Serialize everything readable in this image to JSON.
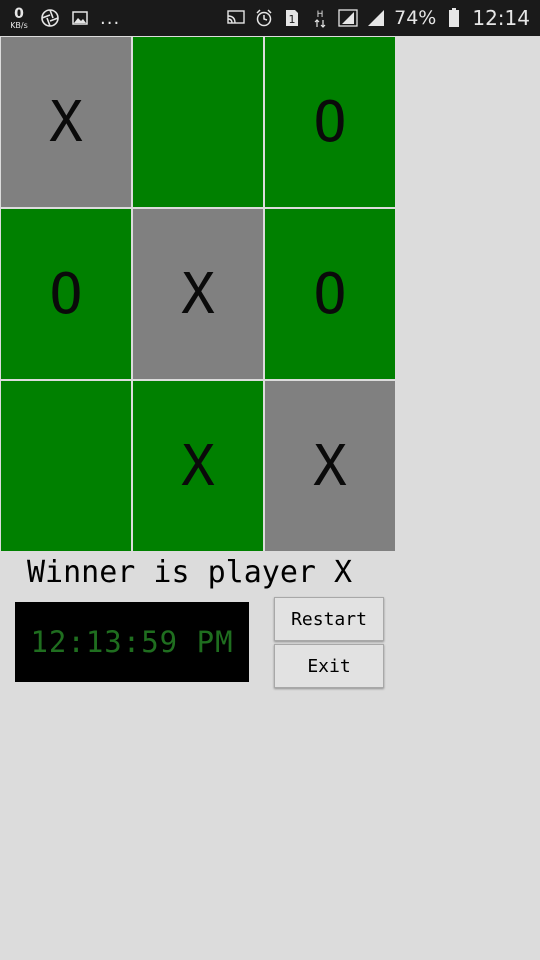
{
  "status_bar": {
    "kbs_value": "0",
    "kbs_unit": "KB/s",
    "more": "...",
    "battery_percent": "74%",
    "time": "12:14",
    "icons": [
      "aperture-icon",
      "image-icon",
      "cast-icon",
      "alarm-icon",
      "sim-1-icon",
      "network-h-icon",
      "signal-icon",
      "signal-icon",
      "battery-icon"
    ]
  },
  "board": {
    "cells": [
      {
        "mark": "X",
        "state": "win"
      },
      {
        "mark": "",
        "state": "normal"
      },
      {
        "mark": "O",
        "state": "normal"
      },
      {
        "mark": "O",
        "state": "normal"
      },
      {
        "mark": "X",
        "state": "win"
      },
      {
        "mark": "O",
        "state": "normal"
      },
      {
        "mark": "",
        "state": "normal"
      },
      {
        "mark": "X",
        "state": "normal"
      },
      {
        "mark": "X",
        "state": "win"
      }
    ]
  },
  "result": {
    "winner_text": "Winner is player X"
  },
  "clock": {
    "display": "12:13:59 PM"
  },
  "buttons": {
    "restart": "Restart",
    "exit": "Exit"
  },
  "colors": {
    "win_cell": "#808080",
    "normal_cell": "#008000",
    "clock_text": "#1f6e1f",
    "background": "#dcdcdc"
  }
}
